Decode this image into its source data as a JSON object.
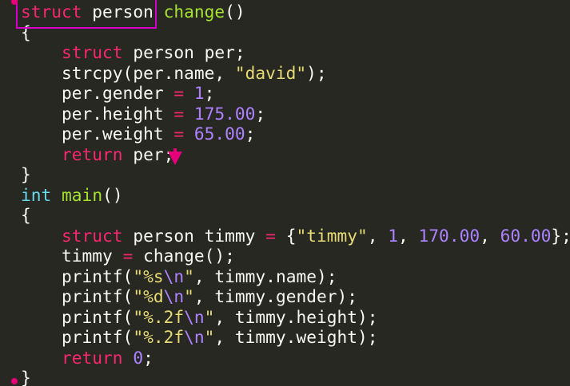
{
  "editor": {
    "lines": [
      {
        "tokens": [
          {
            "t": "struct",
            "c": "kw"
          },
          {
            "t": " person ",
            "c": "plain"
          },
          {
            "t": "change",
            "c": "fn"
          },
          {
            "t": "()",
            "c": "plain"
          }
        ]
      },
      {
        "tokens": [
          {
            "t": "{",
            "c": "plain"
          }
        ]
      },
      {
        "tokens": [
          {
            "t": "    ",
            "c": "plain"
          },
          {
            "t": "struct",
            "c": "kw"
          },
          {
            "t": " person per;",
            "c": "plain"
          }
        ]
      },
      {
        "tokens": [
          {
            "t": "    strcpy(per.name, ",
            "c": "plain"
          },
          {
            "t": "\"david\"",
            "c": "str"
          },
          {
            "t": ");",
            "c": "plain"
          }
        ]
      },
      {
        "tokens": [
          {
            "t": "    per.gender ",
            "c": "plain"
          },
          {
            "t": "=",
            "c": "op"
          },
          {
            "t": " ",
            "c": "plain"
          },
          {
            "t": "1",
            "c": "num"
          },
          {
            "t": ";",
            "c": "plain"
          }
        ]
      },
      {
        "tokens": [
          {
            "t": "    per.height ",
            "c": "plain"
          },
          {
            "t": "=",
            "c": "op"
          },
          {
            "t": " ",
            "c": "plain"
          },
          {
            "t": "175.00",
            "c": "num"
          },
          {
            "t": ";",
            "c": "plain"
          }
        ]
      },
      {
        "tokens": [
          {
            "t": "    per.weight ",
            "c": "plain"
          },
          {
            "t": "=",
            "c": "op"
          },
          {
            "t": " ",
            "c": "plain"
          },
          {
            "t": "65.00",
            "c": "num"
          },
          {
            "t": ";",
            "c": "plain"
          }
        ]
      },
      {
        "tokens": [
          {
            "t": "    ",
            "c": "plain"
          },
          {
            "t": "return",
            "c": "kw"
          },
          {
            "t": " per;",
            "c": "plain"
          }
        ]
      },
      {
        "tokens": [
          {
            "t": "}",
            "c": "plain"
          }
        ]
      },
      {
        "tokens": [
          {
            "t": "int",
            "c": "type"
          },
          {
            "t": " ",
            "c": "plain"
          },
          {
            "t": "main",
            "c": "fn"
          },
          {
            "t": "()",
            "c": "plain"
          }
        ]
      },
      {
        "tokens": [
          {
            "t": "{",
            "c": "plain"
          }
        ]
      },
      {
        "tokens": [
          {
            "t": "    ",
            "c": "plain"
          },
          {
            "t": "struct",
            "c": "kw"
          },
          {
            "t": " person timmy ",
            "c": "plain"
          },
          {
            "t": "=",
            "c": "op"
          },
          {
            "t": " {",
            "c": "plain"
          },
          {
            "t": "\"timmy\"",
            "c": "str"
          },
          {
            "t": ", ",
            "c": "plain"
          },
          {
            "t": "1",
            "c": "num"
          },
          {
            "t": ", ",
            "c": "plain"
          },
          {
            "t": "170.00",
            "c": "num"
          },
          {
            "t": ", ",
            "c": "plain"
          },
          {
            "t": "60.00",
            "c": "num"
          },
          {
            "t": "};",
            "c": "plain"
          }
        ]
      },
      {
        "tokens": [
          {
            "t": "    timmy ",
            "c": "plain"
          },
          {
            "t": "=",
            "c": "op"
          },
          {
            "t": " change();",
            "c": "plain"
          }
        ]
      },
      {
        "tokens": [
          {
            "t": "    printf(",
            "c": "plain"
          },
          {
            "t": "\"%s",
            "c": "str"
          },
          {
            "t": "\\n",
            "c": "esc"
          },
          {
            "t": "\"",
            "c": "str"
          },
          {
            "t": ", timmy.name);",
            "c": "plain"
          }
        ]
      },
      {
        "tokens": [
          {
            "t": "    printf(",
            "c": "plain"
          },
          {
            "t": "\"%d",
            "c": "str"
          },
          {
            "t": "\\n",
            "c": "esc"
          },
          {
            "t": "\"",
            "c": "str"
          },
          {
            "t": ", timmy.gender);",
            "c": "plain"
          }
        ]
      },
      {
        "tokens": [
          {
            "t": "    printf(",
            "c": "plain"
          },
          {
            "t": "\"%.2f",
            "c": "str"
          },
          {
            "t": "\\n",
            "c": "esc"
          },
          {
            "t": "\"",
            "c": "str"
          },
          {
            "t": ", timmy.height);",
            "c": "plain"
          }
        ]
      },
      {
        "tokens": [
          {
            "t": "    printf(",
            "c": "plain"
          },
          {
            "t": "\"%.2f",
            "c": "str"
          },
          {
            "t": "\\n",
            "c": "esc"
          },
          {
            "t": "\"",
            "c": "str"
          },
          {
            "t": ", timmy.weight);",
            "c": "plain"
          }
        ]
      },
      {
        "tokens": [
          {
            "t": "    ",
            "c": "plain"
          },
          {
            "t": "return",
            "c": "kw"
          },
          {
            "t": " ",
            "c": "plain"
          },
          {
            "t": "0",
            "c": "num"
          },
          {
            "t": ";",
            "c": "plain"
          }
        ]
      },
      {
        "tokens": [
          {
            "t": "}",
            "c": "plain"
          }
        ]
      }
    ]
  },
  "colors": {
    "background": "#272822",
    "keyword": "#f92672",
    "type": "#66d9ef",
    "function": "#a6e22e",
    "string": "#e6db74",
    "number": "#ae81ff",
    "annotation": "#d400c8"
  }
}
